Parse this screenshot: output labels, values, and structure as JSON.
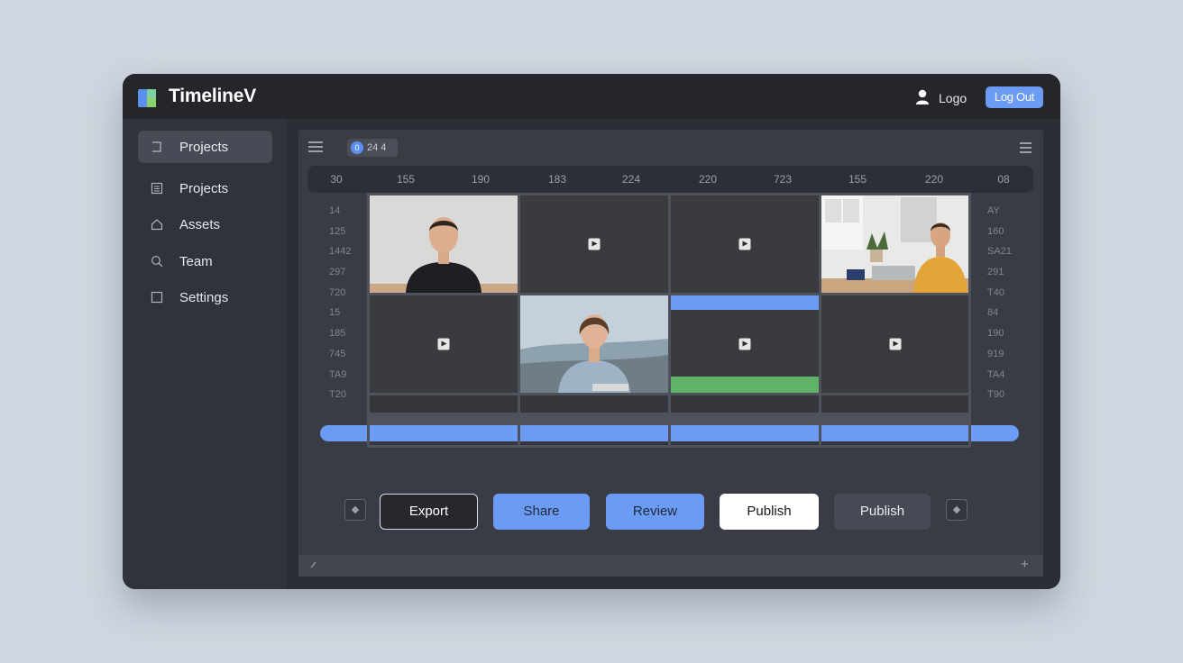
{
  "app": {
    "title": "TimelineV"
  },
  "header": {
    "user_name": "Logo",
    "logout_label": "Log Out"
  },
  "sidebar": {
    "items": [
      {
        "label": "Projects",
        "icon": "bracket-icon",
        "active": true
      },
      {
        "label": "Projects",
        "icon": "list-icon",
        "active": false
      },
      {
        "label": "Assets",
        "icon": "home-icon",
        "active": false
      },
      {
        "label": "Team",
        "icon": "search-icon",
        "active": false
      },
      {
        "label": "Settings",
        "icon": "square-icon",
        "active": false
      }
    ]
  },
  "toolbar": {
    "chip_count": "0",
    "chip_text": "24 4"
  },
  "ruler": {
    "ticks": [
      "30",
      "155",
      "190",
      "183",
      "224",
      "220",
      "723",
      "155",
      "220",
      "08"
    ]
  },
  "left_labels": [
    "14",
    "125",
    "1442",
    "297",
    "720",
    "15",
    "185",
    "745",
    "TA9",
    "T20"
  ],
  "right_labels": [
    "AY",
    "160",
    "SA21",
    "291",
    "T40",
    "84",
    "190",
    "919",
    "TA4",
    "T90"
  ],
  "clips": [
    {
      "row": 0,
      "col": 0,
      "kind": "photo",
      "subject": "man-black-shirt"
    },
    {
      "row": 0,
      "col": 1,
      "kind": "video"
    },
    {
      "row": 0,
      "col": 2,
      "kind": "video"
    },
    {
      "row": 0,
      "col": 3,
      "kind": "photo",
      "subject": "man-yellow-sweater-office"
    },
    {
      "row": 1,
      "col": 0,
      "kind": "video"
    },
    {
      "row": 1,
      "col": 1,
      "kind": "photo",
      "subject": "woman-blue-sweater"
    },
    {
      "row": 1,
      "col": 2,
      "kind": "video",
      "overlay": [
        "blue-top",
        "green-bottom"
      ]
    },
    {
      "row": 1,
      "col": 3,
      "kind": "video"
    }
  ],
  "colors": {
    "accent": "#6b9bf2",
    "green": "#5fb268",
    "window": "#2b2e35"
  },
  "actions": {
    "export": "Export",
    "share": "Share",
    "review": "Review",
    "publish_primary": "Publish",
    "publish_secondary": "Publish"
  },
  "status": {
    "left_icon": "pencil-icon",
    "right_label": "+"
  }
}
